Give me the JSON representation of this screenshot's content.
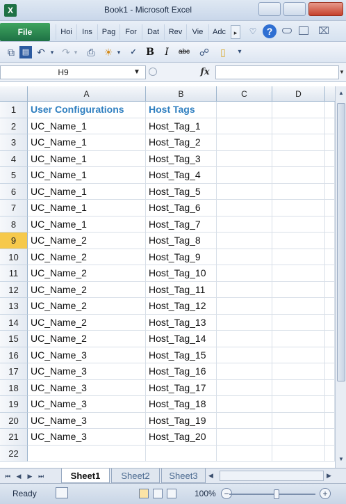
{
  "window": {
    "app_icon": "X",
    "title": "Book1 - Microsoft Excel"
  },
  "ribbon": {
    "file_tab": "File",
    "tabs": [
      "Hoi",
      "Ins",
      "Pag",
      "For",
      "Dat",
      "Rev",
      "Vie",
      "Adc"
    ],
    "right_icons": [
      "expand-icon",
      "help-icon",
      "minimize-ribbon-icon",
      "restore-icon",
      "close-icon"
    ]
  },
  "quick_access": [
    "copy-icon",
    "save-icon",
    "undo-icon",
    "redo-icon",
    "print-preview-icon",
    "paint-icon",
    "spelling-icon",
    "bold-icon",
    "italic-icon",
    "strikethrough-icon",
    "find-icon",
    "folder-icon",
    "customize-icon"
  ],
  "formula_bar": {
    "name_box": "H9",
    "fx_label": "fx",
    "formula_value": ""
  },
  "grid": {
    "columns": [
      "A",
      "B",
      "C",
      "D"
    ],
    "rows": [
      {
        "num": "1",
        "a": "User Configurations",
        "b": "Host Tags"
      },
      {
        "num": "2",
        "a": "UC_Name_1",
        "b": "Host_Tag_1"
      },
      {
        "num": "3",
        "a": "UC_Name_1",
        "b": "Host_Tag_2"
      },
      {
        "num": "4",
        "a": "UC_Name_1",
        "b": "Host_Tag_3"
      },
      {
        "num": "5",
        "a": "UC_Name_1",
        "b": "Host_Tag_4"
      },
      {
        "num": "6",
        "a": "UC_Name_1",
        "b": "Host_Tag_5"
      },
      {
        "num": "7",
        "a": "UC_Name_1",
        "b": "Host_Tag_6"
      },
      {
        "num": "8",
        "a": "UC_Name_1",
        "b": "Host_Tag_7"
      },
      {
        "num": "9",
        "a": "UC_Name_2",
        "b": "Host_Tag_8"
      },
      {
        "num": "10",
        "a": "UC_Name_2",
        "b": "Host_Tag_9"
      },
      {
        "num": "11",
        "a": "UC_Name_2",
        "b": "Host_Tag_10"
      },
      {
        "num": "12",
        "a": "UC_Name_2",
        "b": "Host_Tag_11"
      },
      {
        "num": "13",
        "a": "UC_Name_2",
        "b": "Host_Tag_12"
      },
      {
        "num": "14",
        "a": "UC_Name_2",
        "b": "Host_Tag_13"
      },
      {
        "num": "15",
        "a": "UC_Name_2",
        "b": "Host_Tag_14"
      },
      {
        "num": "16",
        "a": "UC_Name_3",
        "b": "Host_Tag_15"
      },
      {
        "num": "17",
        "a": "UC_Name_3",
        "b": "Host_Tag_16"
      },
      {
        "num": "18",
        "a": "UC_Name_3",
        "b": "Host_Tag_17"
      },
      {
        "num": "19",
        "a": "UC_Name_3",
        "b": "Host_Tag_18"
      },
      {
        "num": "20",
        "a": "UC_Name_3",
        "b": "Host_Tag_19"
      },
      {
        "num": "21",
        "a": "UC_Name_3",
        "b": "Host_Tag_20"
      },
      {
        "num": "22",
        "a": "",
        "b": ""
      }
    ],
    "selected_row": "9"
  },
  "sheets": {
    "tabs": [
      "Sheet1",
      "Sheet2",
      "Sheet3"
    ],
    "active": "Sheet1"
  },
  "status": {
    "ready": "Ready",
    "zoom": "100%",
    "zoom_level_percent": 100
  },
  "colors": {
    "header_text": "#2f7fc0",
    "file_tab": "#1e7145",
    "selected_row_header": "#f6c94b"
  }
}
